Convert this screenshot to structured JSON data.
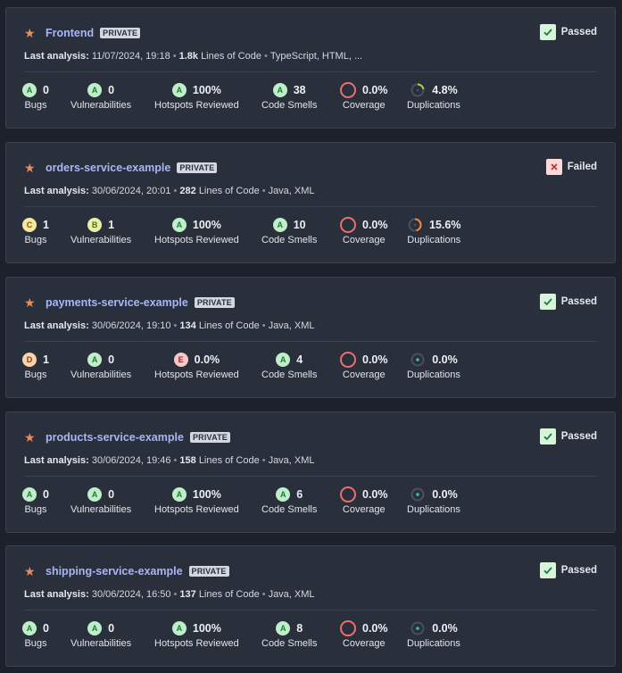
{
  "projects": [
    {
      "name": "Frontend",
      "badge": "PRIVATE",
      "gate": "Passed",
      "gate_status": "pass",
      "meta": {
        "label": "Last analysis:",
        "date": "11/07/2024, 19:18",
        "loc": "1.8k",
        "loc_label": "Lines of Code",
        "langs": "TypeScript, HTML, ..."
      },
      "bugs": {
        "rating": "A",
        "value": "0",
        "label": "Bugs"
      },
      "vulns": {
        "rating": "A",
        "value": "0",
        "label": "Vulnerabilities"
      },
      "hotspots": {
        "rating": "A",
        "value": "100%",
        "label": "Hotspots Reviewed"
      },
      "smells": {
        "rating": "A",
        "value": "38",
        "label": "Code Smells"
      },
      "coverage": {
        "value": "0.0%",
        "label": "Coverage"
      },
      "dup": {
        "value": "4.8%",
        "label": "Duplications",
        "level": 0.048,
        "color": "#b5c93a"
      }
    },
    {
      "name": "orders-service-example",
      "badge": "PRIVATE",
      "gate": "Failed",
      "gate_status": "fail",
      "meta": {
        "label": "Last analysis:",
        "date": "30/06/2024, 20:01",
        "loc": "282",
        "loc_label": "Lines of Code",
        "langs": "Java, XML"
      },
      "bugs": {
        "rating": "C",
        "value": "1",
        "label": "Bugs"
      },
      "vulns": {
        "rating": "B",
        "value": "1",
        "label": "Vulnerabilities"
      },
      "hotspots": {
        "rating": "A",
        "value": "100%",
        "label": "Hotspots Reviewed"
      },
      "smells": {
        "rating": "A",
        "value": "10",
        "label": "Code Smells"
      },
      "coverage": {
        "value": "0.0%",
        "label": "Coverage"
      },
      "dup": {
        "value": "15.6%",
        "label": "Duplications",
        "level": 0.156,
        "color": "#f08a3a"
      }
    },
    {
      "name": "payments-service-example",
      "badge": "PRIVATE",
      "gate": "Passed",
      "gate_status": "pass",
      "meta": {
        "label": "Last analysis:",
        "date": "30/06/2024, 19:10",
        "loc": "134",
        "loc_label": "Lines of Code",
        "langs": "Java, XML"
      },
      "bugs": {
        "rating": "D",
        "value": "1",
        "label": "Bugs"
      },
      "vulns": {
        "rating": "A",
        "value": "0",
        "label": "Vulnerabilities"
      },
      "hotspots": {
        "rating": "E",
        "value": "0.0%",
        "label": "Hotspots Reviewed"
      },
      "smells": {
        "rating": "A",
        "value": "4",
        "label": "Code Smells"
      },
      "coverage": {
        "value": "0.0%",
        "label": "Coverage"
      },
      "dup": {
        "value": "0.0%",
        "label": "Duplications",
        "level": 0,
        "color": "#2ec98a"
      }
    },
    {
      "name": "products-service-example",
      "badge": "PRIVATE",
      "gate": "Passed",
      "gate_status": "pass",
      "meta": {
        "label": "Last analysis:",
        "date": "30/06/2024, 19:46",
        "loc": "158",
        "loc_label": "Lines of Code",
        "langs": "Java, XML"
      },
      "bugs": {
        "rating": "A",
        "value": "0",
        "label": "Bugs"
      },
      "vulns": {
        "rating": "A",
        "value": "0",
        "label": "Vulnerabilities"
      },
      "hotspots": {
        "rating": "A",
        "value": "100%",
        "label": "Hotspots Reviewed"
      },
      "smells": {
        "rating": "A",
        "value": "6",
        "label": "Code Smells"
      },
      "coverage": {
        "value": "0.0%",
        "label": "Coverage"
      },
      "dup": {
        "value": "0.0%",
        "label": "Duplications",
        "level": 0,
        "color": "#2ec98a"
      }
    },
    {
      "name": "shipping-service-example",
      "badge": "PRIVATE",
      "gate": "Passed",
      "gate_status": "pass",
      "meta": {
        "label": "Last analysis:",
        "date": "30/06/2024, 16:50",
        "loc": "137",
        "loc_label": "Lines of Code",
        "langs": "Java, XML"
      },
      "bugs": {
        "rating": "A",
        "value": "0",
        "label": "Bugs"
      },
      "vulns": {
        "rating": "A",
        "value": "0",
        "label": "Vulnerabilities"
      },
      "hotspots": {
        "rating": "A",
        "value": "100%",
        "label": "Hotspots Reviewed"
      },
      "smells": {
        "rating": "A",
        "value": "8",
        "label": "Code Smells"
      },
      "coverage": {
        "value": "0.0%",
        "label": "Coverage"
      },
      "dup": {
        "value": "0.0%",
        "label": "Duplications",
        "level": 0,
        "color": "#2ec98a"
      }
    }
  ],
  "icons": {
    "star": "star-icon",
    "pass": "check-icon",
    "fail": "close-icon"
  },
  "colors": {
    "link": "#a9b6f5",
    "star": "#f08a5d",
    "coverage_ring": "#e9706e",
    "card_bg": "#2a2f3c",
    "page_bg": "#1d212c"
  }
}
